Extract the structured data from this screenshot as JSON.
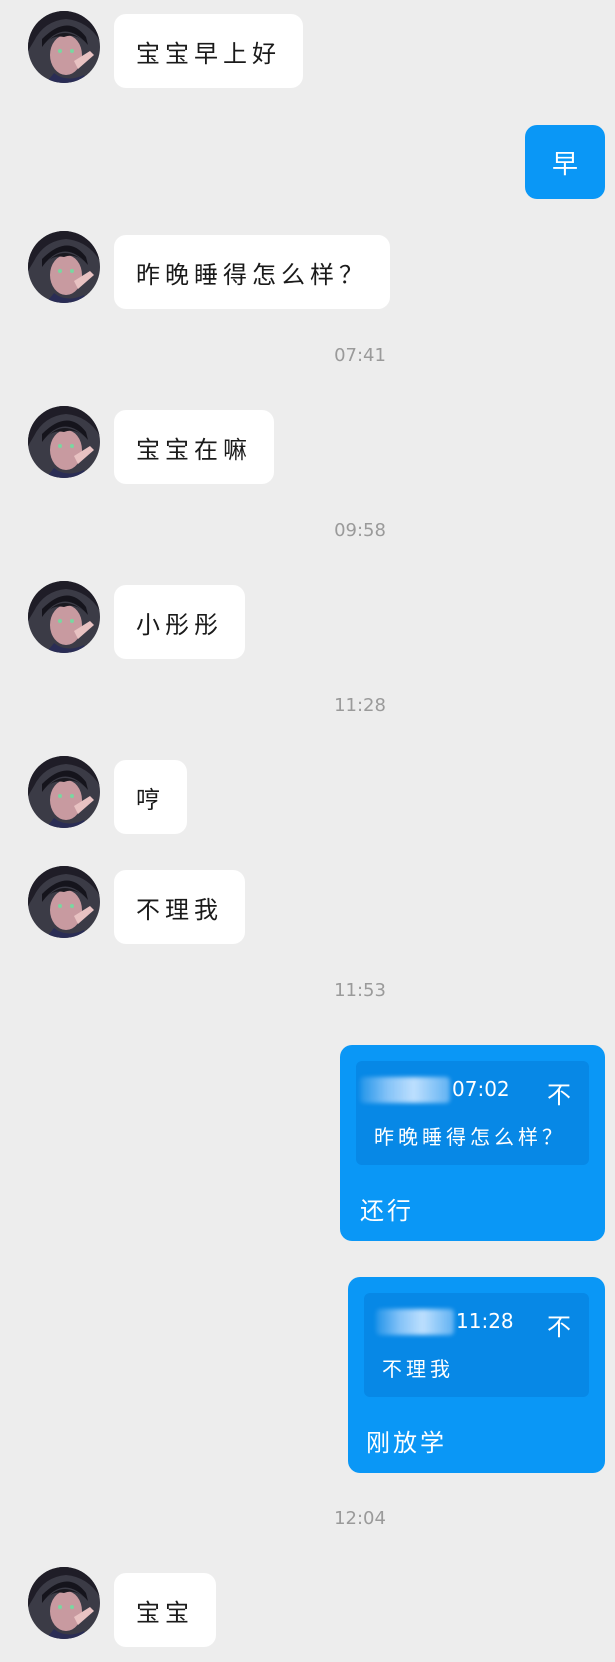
{
  "colors": {
    "background": "#ededed",
    "incoming_bubble": "#ffffff",
    "outgoing_bubble": "#0a97f6",
    "quote_box": "#0788e6",
    "timestamp": "#9a9a9a"
  },
  "conversation": {
    "msg1": "宝宝早上好",
    "reply1": "早",
    "msg2": "昨晚睡得怎么样？",
    "ts1": "07:41",
    "msg3": "宝宝在嘛",
    "ts2": "09:58",
    "msg4": "小彤彤",
    "ts3": "11:28",
    "msg5": "哼",
    "msg6": "不理我",
    "ts4": "11:53",
    "quote1": {
      "time": "07:02",
      "action_icon": "不",
      "text": "昨晚睡得怎么样？",
      "reply": "还行"
    },
    "quote2": {
      "time": "11:28",
      "action_icon": "不",
      "text": "不理我",
      "reply": "刚放学"
    },
    "ts5": "12:04",
    "msg7": "宝宝"
  }
}
